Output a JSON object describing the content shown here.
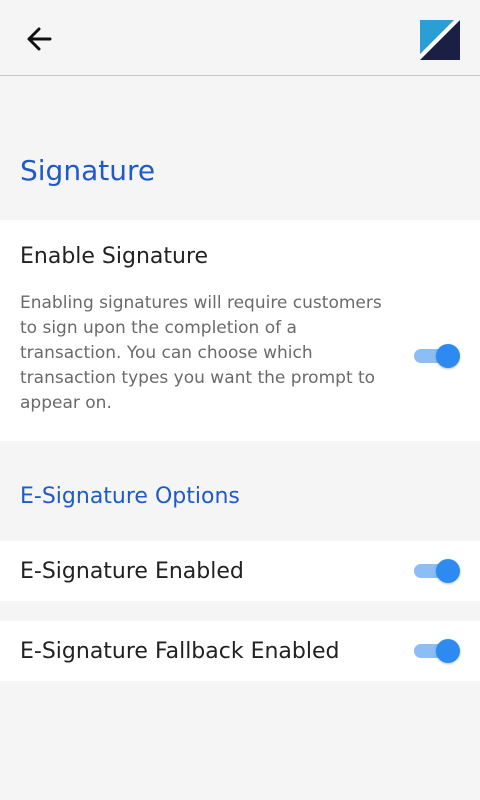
{
  "header": {
    "back_icon": "arrow-left-icon",
    "logo": "brand-logo"
  },
  "signature_section": {
    "title": "Signature",
    "enable_signature": {
      "title": "Enable Signature",
      "description": "Enabling signatures will require customers to sign upon the completion of a transaction. You can choose which transaction types you want the prompt to appear on.",
      "enabled": true
    }
  },
  "esignature_section": {
    "title": "E-Signature Options",
    "items": [
      {
        "label": "E-Signature Enabled",
        "enabled": true
      },
      {
        "label": "E-Signature Fallback Enabled",
        "enabled": true
      }
    ]
  },
  "colors": {
    "accent": "#1e5bc6",
    "toggle_on": "#2c8af1",
    "toggle_track": "#8dbdf5",
    "logo_dark": "#1b1f45",
    "logo_light": "#2a9fd6"
  }
}
